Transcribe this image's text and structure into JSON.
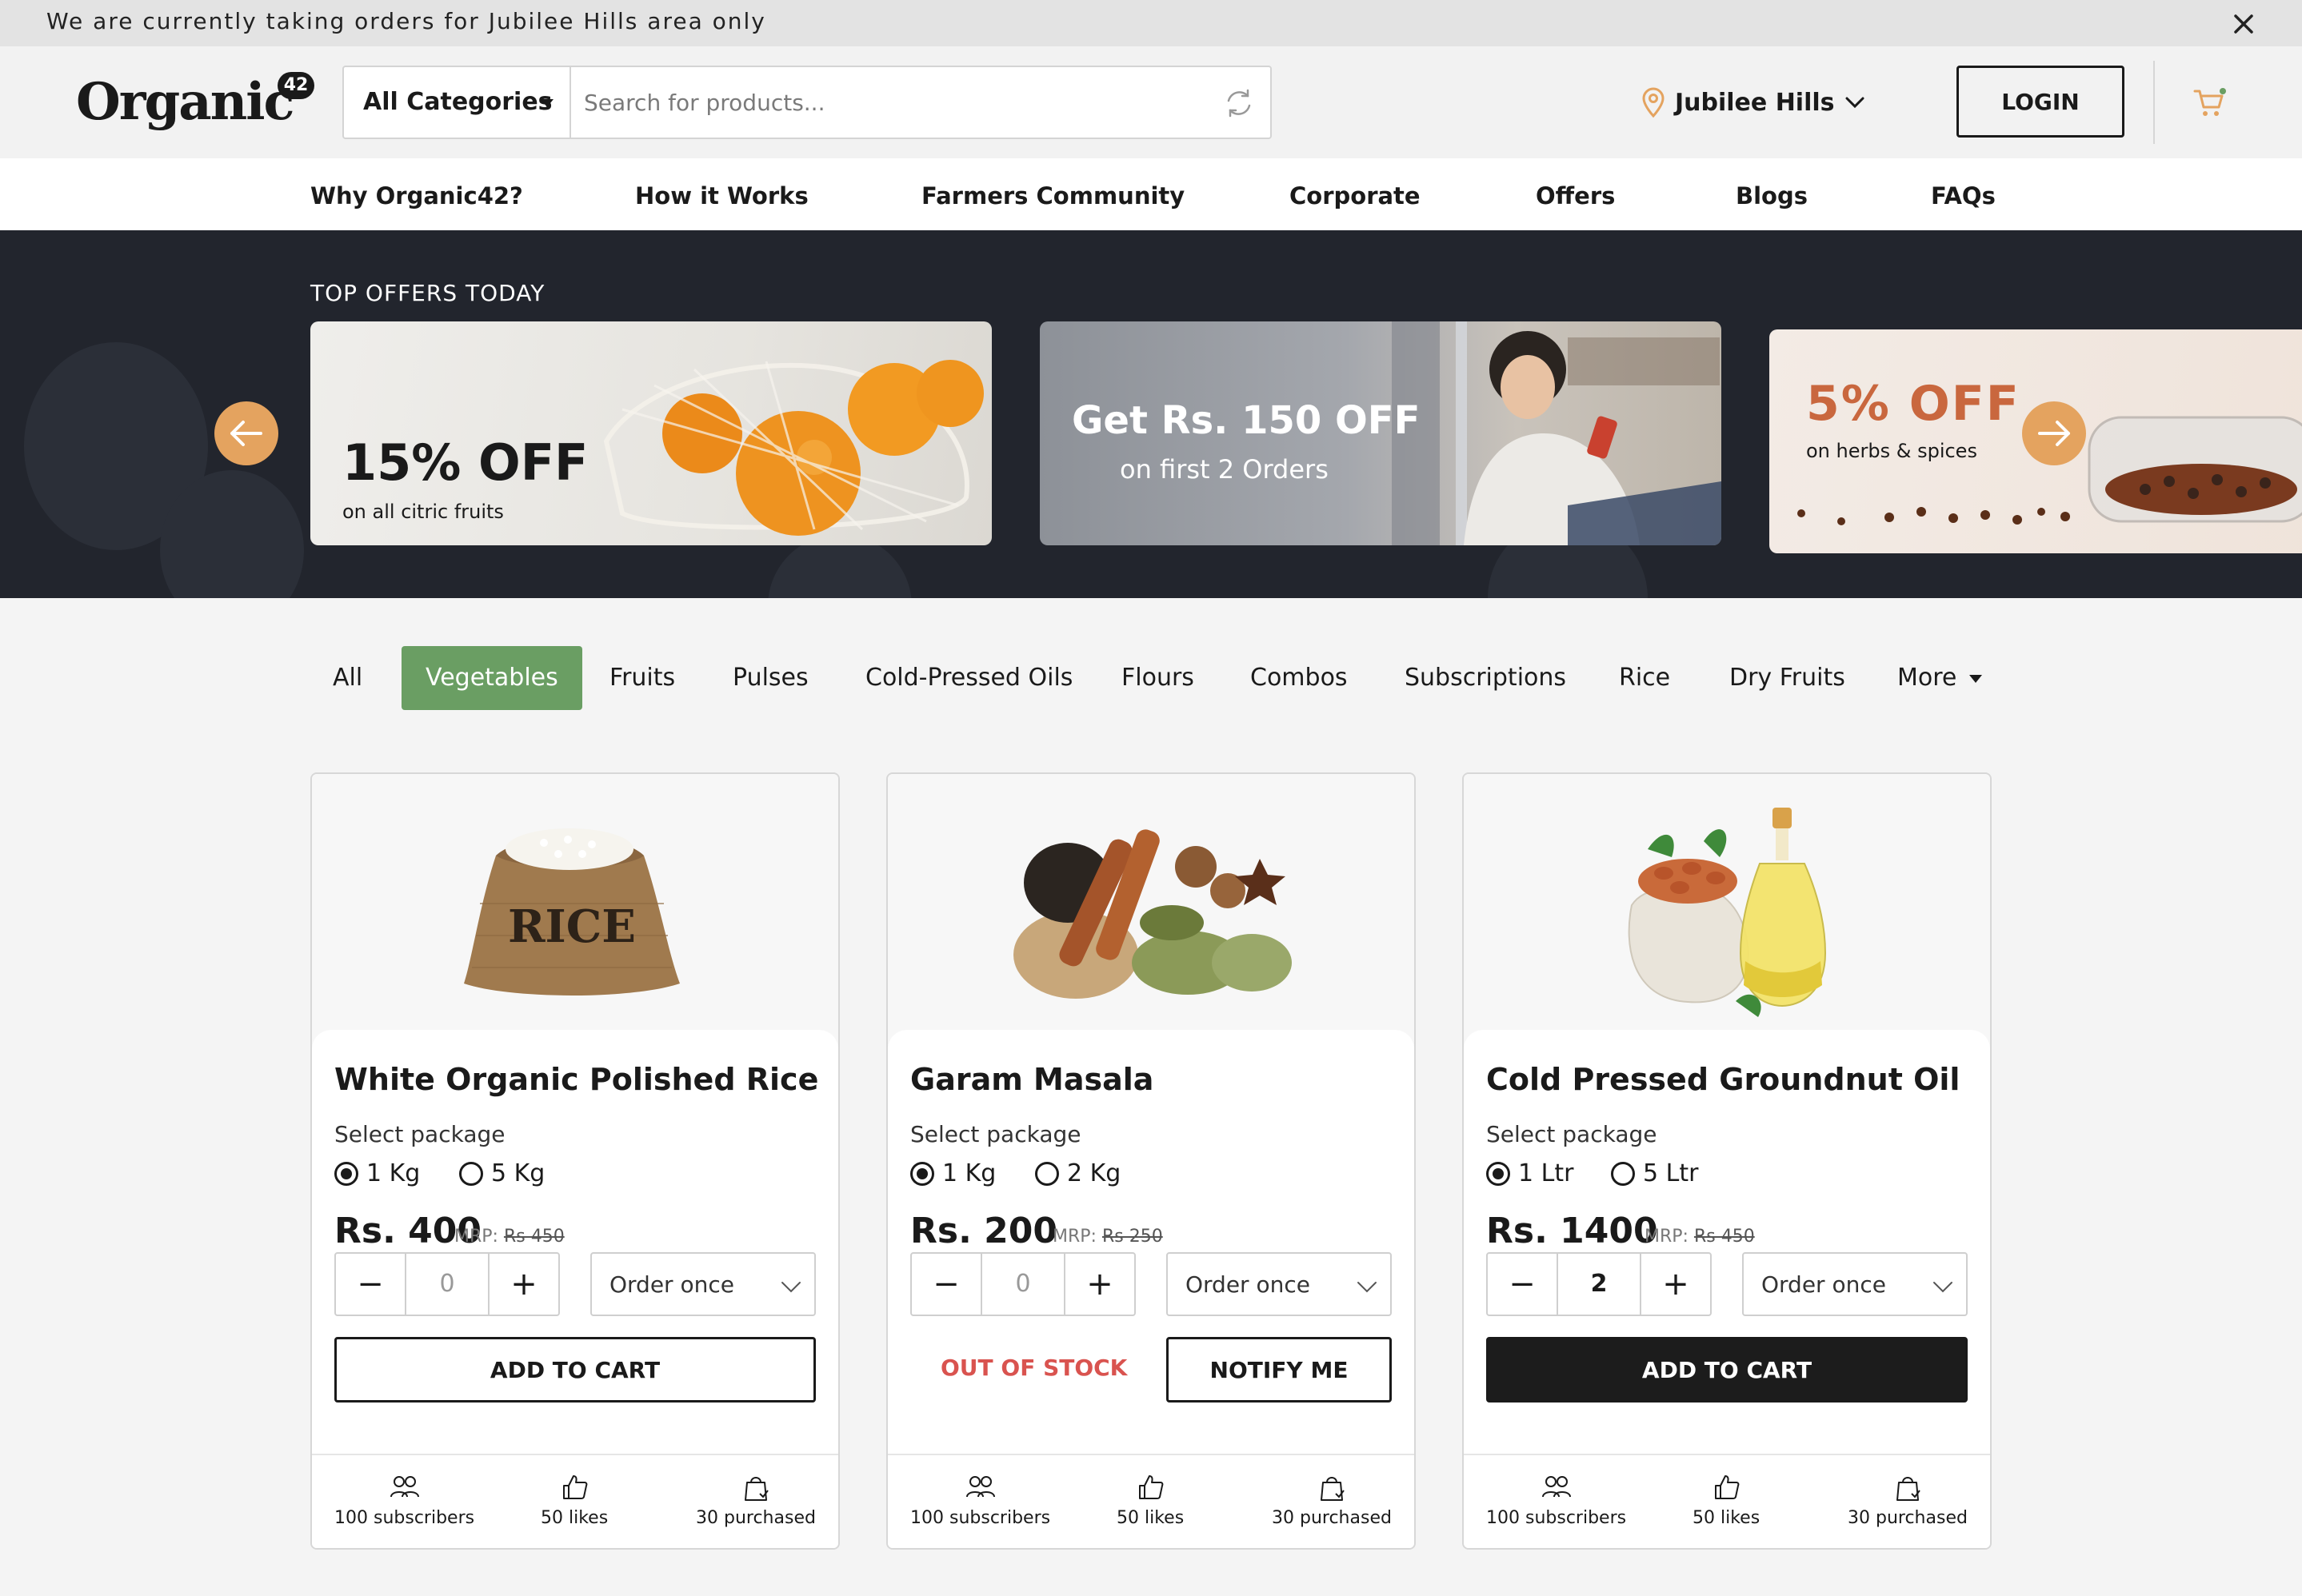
{
  "announcement": {
    "text": "We are currently taking orders for Jubilee Hills area only"
  },
  "header": {
    "logo_text": "Organic",
    "logo_badge": "42",
    "category_select": "All Categories",
    "search_placeholder": "Search for products...",
    "location": "Jubilee Hills",
    "login_label": "LOGIN"
  },
  "nav": [
    "Why Organic42?",
    "How it Works",
    "Farmers Community",
    "Corporate",
    "Offers",
    "Blogs",
    "FAQs"
  ],
  "hero": {
    "title": "TOP OFFERS TODAY",
    "offers": [
      {
        "headline": "15% OFF",
        "sub": "on all citric fruits"
      },
      {
        "headline": "Get Rs. 150 OFF",
        "sub": "on first 2 Orders"
      },
      {
        "headline": "5% OFF",
        "sub": "on herbs & spices"
      }
    ]
  },
  "tabs": {
    "active": "Vegetables",
    "items": [
      "All",
      "Vegetables",
      "Fruits",
      "Pulses",
      "Cold-Pressed Oils",
      "Flours",
      "Combos",
      "Subscriptions",
      "Rice",
      "Dry Fruits",
      "More"
    ]
  },
  "products": [
    {
      "name": "White Organic Polished Rice",
      "package_label": "Select package",
      "options": [
        "1 Kg",
        "5 Kg"
      ],
      "selected_option": "1 Kg",
      "price": "Rs. 400",
      "mrp_label": "MRP:",
      "mrp": "Rs 450",
      "quantity": "0",
      "frequency": "Order once",
      "primary_action": "ADD TO CART",
      "stock_status": "",
      "stats": {
        "subscribers": "100 subscribers",
        "likes": "50 likes",
        "purchased": "30 purchased"
      },
      "image_label": "RICE"
    },
    {
      "name": "Garam Masala",
      "package_label": "Select package",
      "options": [
        "1 Kg",
        "2 Kg"
      ],
      "selected_option": "1 Kg",
      "price": "Rs. 200",
      "mrp_label": "MRP:",
      "mrp": "Rs 250",
      "quantity": "0",
      "frequency": "Order once",
      "primary_action": "NOTIFY ME",
      "stock_status": "OUT OF STOCK",
      "stats": {
        "subscribers": "100 subscribers",
        "likes": "50 likes",
        "purchased": "30 purchased"
      }
    },
    {
      "name": "Cold Pressed Groundnut Oil",
      "package_label": "Select package",
      "options": [
        "1 Ltr",
        "5 Ltr"
      ],
      "selected_option": "1 Ltr",
      "price": "Rs. 1400",
      "mrp_label": "MRP:",
      "mrp": "Rs 450",
      "quantity": "2",
      "frequency": "Order once",
      "primary_action": "ADD TO CART",
      "stock_status": "",
      "stats": {
        "subscribers": "100 subscribers",
        "likes": "50 likes",
        "purchased": "30 purchased"
      }
    }
  ],
  "colors": {
    "brand_green": "#6a9e63",
    "accent_orange": "#e4a35f",
    "hero_bg": "#22252d",
    "out_of_stock": "#d9534f",
    "dark_button": "#1c1c1c"
  }
}
